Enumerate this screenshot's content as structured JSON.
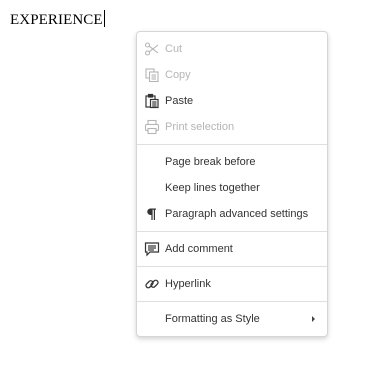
{
  "document": {
    "text": "EXPERIENCE"
  },
  "menu": {
    "cut": "Cut",
    "copy": "Copy",
    "paste": "Paste",
    "print_selection": "Print selection",
    "page_break_before": "Page break before",
    "keep_lines_together": "Keep lines together",
    "paragraph_advanced": "Paragraph advanced settings",
    "add_comment": "Add comment",
    "hyperlink": "Hyperlink",
    "formatting_as_style": "Formatting as Style",
    "icons": [
      "scissors-icon",
      "copy-icon",
      "paste-icon",
      "printer-icon",
      "pilcrow-icon",
      "comment-icon",
      "link-icon",
      "chevron-right-icon"
    ]
  },
  "colors": {
    "enabled_text": "#333333",
    "disabled_text": "#b5b5b5",
    "separator": "#dfdfdf"
  }
}
